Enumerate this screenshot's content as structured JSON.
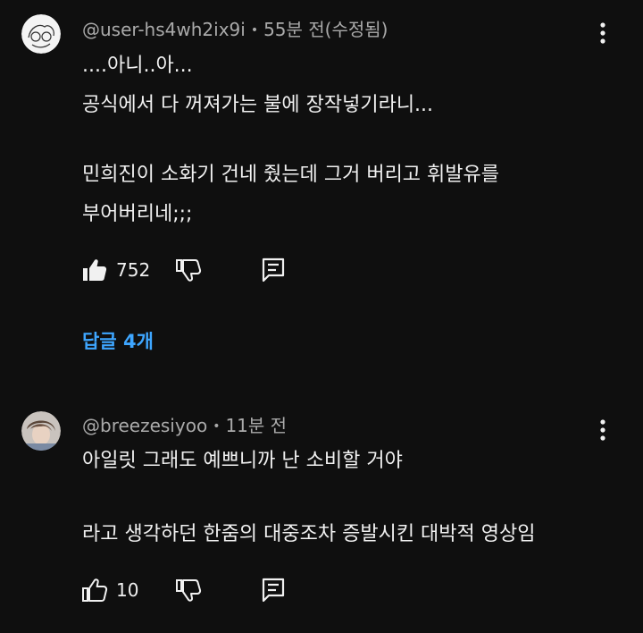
{
  "comments": [
    {
      "author": "@user-hs4wh2ix9i",
      "separator": "•",
      "time": "55분 전(수정됨)",
      "lines": [
        "....아니..아...",
        "공식에서 다 꺼져가는 불에 장작넣기라니...",
        "",
        "민희진이 소화기 건네 줬는데 그거 버리고 휘발유를",
        "부어버리네;;;"
      ],
      "likes": "752",
      "liked": true,
      "replies_label": "답글 4개"
    },
    {
      "author": "@breezesiyoo",
      "separator": "•",
      "time": "11분 전",
      "lines": [
        "아일릿 그래도 예쁘니까 난 소비할 거야",
        "",
        "라고 생각하던 한줌의 대중조차 증발시킨 대박적 영상임"
      ],
      "likes": "10",
      "liked": false
    }
  ],
  "icons": {
    "like": "thumbs-up-icon",
    "dislike": "thumbs-down-icon",
    "reply": "reply-comment-icon",
    "menu": "more-vert-icon"
  },
  "colors": {
    "background": "#0f0f0f",
    "text": "#f1f1f1",
    "secondary_text": "#aaaaaa",
    "link": "#3ea6ff"
  }
}
